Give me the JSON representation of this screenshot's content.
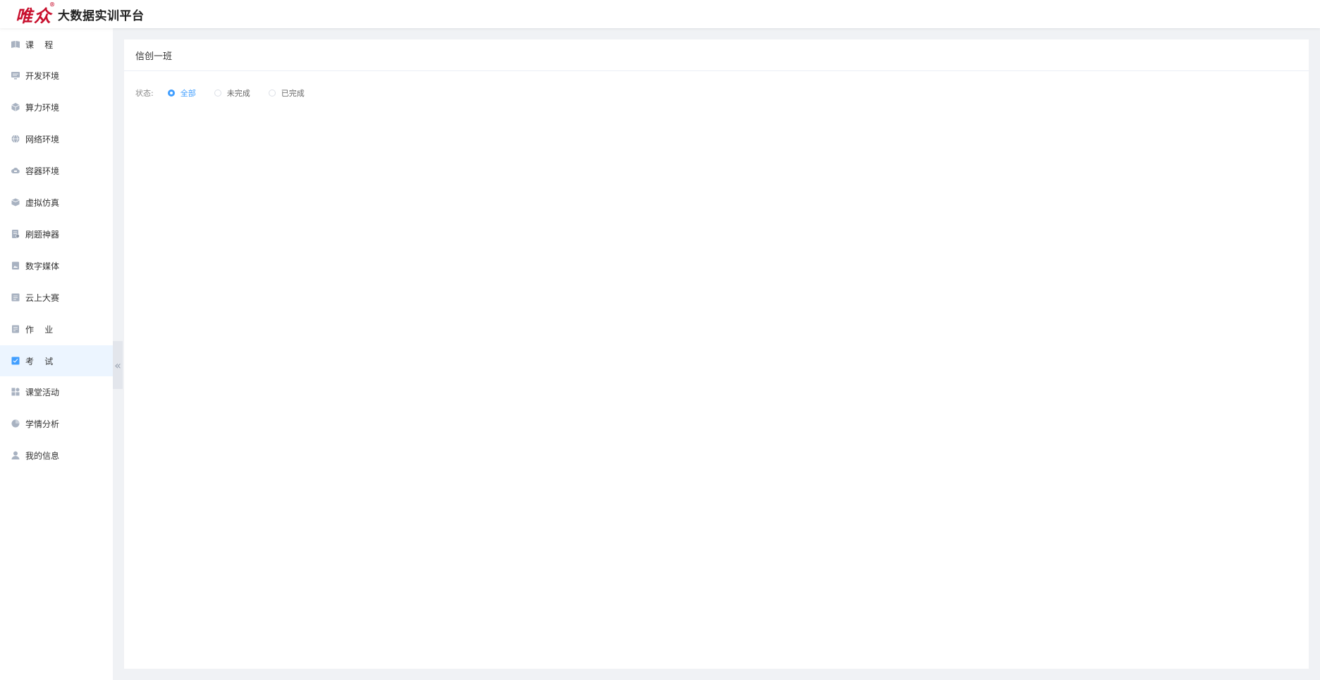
{
  "app": {
    "brand": "唯众",
    "registered_mark": "®",
    "title": "大数据实训平台"
  },
  "sidebar": {
    "items": [
      {
        "label": "课    程",
        "icon": "book-icon"
      },
      {
        "label": "开发环境",
        "icon": "monitor-icon"
      },
      {
        "label": "算力环境",
        "icon": "cube-icon"
      },
      {
        "label": "网络环境",
        "icon": "globe-icon"
      },
      {
        "label": "容器环境",
        "icon": "cloud-icon"
      },
      {
        "label": "虚拟仿真",
        "icon": "box-icon"
      },
      {
        "label": "刷题神器",
        "icon": "quiz-icon"
      },
      {
        "label": "数字媒体",
        "icon": "image-icon"
      },
      {
        "label": "云上大赛",
        "icon": "trophy-icon"
      },
      {
        "label": "作    业",
        "icon": "homework-icon"
      },
      {
        "label": "考    试",
        "icon": "exam-icon",
        "active": true
      },
      {
        "label": "课堂活动",
        "icon": "grid-icon"
      },
      {
        "label": "学情分析",
        "icon": "pie-chart-icon"
      },
      {
        "label": "我的信息",
        "icon": "user-icon"
      }
    ],
    "collapse_glyph": "«"
  },
  "main": {
    "class_name": "信创一班",
    "filter": {
      "label": "状态:",
      "options": [
        {
          "label": "全部",
          "checked": true
        },
        {
          "label": "未完成",
          "checked": false
        },
        {
          "label": "已完成",
          "checked": false
        }
      ]
    }
  },
  "colors": {
    "accent": "#409eff",
    "brand": "#c8102e",
    "active_bg": "#ecf5ff",
    "icon_gray": "#a8b2c1"
  }
}
